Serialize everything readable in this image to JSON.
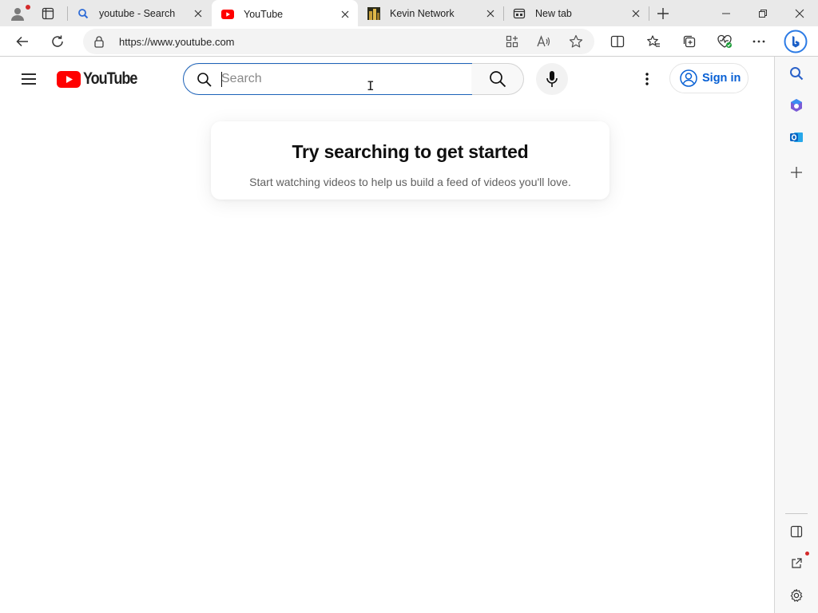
{
  "browser": {
    "tabs": [
      {
        "title": "youtube - Search",
        "active": false,
        "favicon": "search-icon"
      },
      {
        "title": "YouTube",
        "active": true,
        "favicon": "youtube-icon"
      },
      {
        "title": "Kevin Network",
        "active": false,
        "favicon": "kevin-network-icon"
      },
      {
        "title": "New tab",
        "active": false,
        "favicon": "newtab-icon"
      }
    ],
    "url": "https://www.youtube.com",
    "accent": "#1c62b9"
  },
  "youtube": {
    "logo_text": "YouTube",
    "logo_color": "#ff0000",
    "search_placeholder": "Search",
    "search_value": "",
    "sign_in_label": "Sign in",
    "empty_title": "Try searching to get started",
    "empty_subtitle": "Start watching videos to help us build a feed of videos you'll love.",
    "link_color": "#065fd4"
  },
  "sidebar": {
    "icons": [
      "search-icon",
      "copilot-icon",
      "outlook-icon",
      "add-icon",
      "hide-sidebar-icon",
      "external-link-icon",
      "settings-icon"
    ]
  }
}
